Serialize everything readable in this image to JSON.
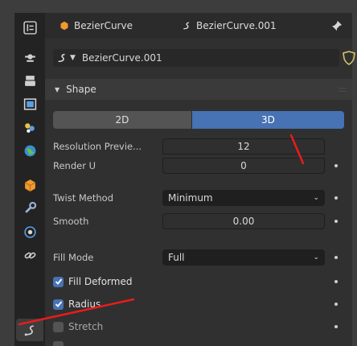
{
  "header": {
    "object_name": "BezierCurve",
    "data_name": "BezierCurve.001"
  },
  "datablock": {
    "name": "BezierCurve.001"
  },
  "panel": {
    "title": "Shape"
  },
  "dimensions": {
    "option_2d": "2D",
    "option_3d": "3D",
    "selected": "3D"
  },
  "properties": {
    "resolution_preview": {
      "label": "Resolution Previe...",
      "value": "12"
    },
    "render_u": {
      "label": "Render U",
      "value": "0"
    },
    "twist_method": {
      "label": "Twist Method",
      "value": "Minimum"
    },
    "smooth": {
      "label": "Smooth",
      "value": "0.00"
    },
    "fill_mode": {
      "label": "Fill Mode",
      "value": "Full"
    },
    "fill_deformed": {
      "label": "Fill Deformed",
      "checked": true
    },
    "radius": {
      "label": "Radius",
      "checked": true
    },
    "stretch": {
      "label": "Stretch",
      "checked": false
    }
  },
  "colors": {
    "accent": "#4772b3",
    "annotation": "#e81c1c"
  },
  "tabs": [
    "tool-icon",
    "render-icon",
    "output-icon",
    "view-layer-icon",
    "scene-icon",
    "world-icon",
    "object-icon",
    "modifier-icon",
    "physics-icon",
    "constraint-icon",
    "curve-data-icon"
  ]
}
